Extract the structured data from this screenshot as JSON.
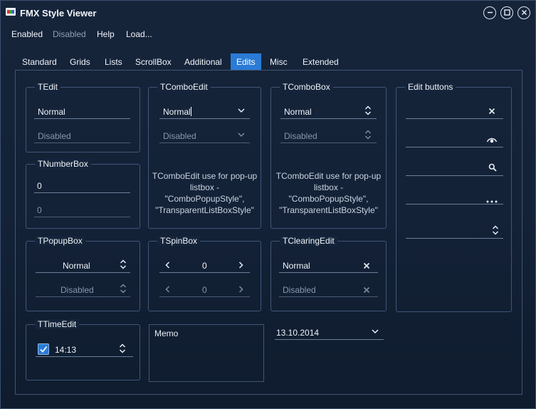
{
  "window": {
    "title": "FMX Style Viewer"
  },
  "menu": {
    "enabled": "Enabled",
    "disabled": "Disabled",
    "help": "Help",
    "load": "Load..."
  },
  "tabs": [
    "Standard",
    "Grids",
    "Lists",
    "ScrollBox",
    "Additional",
    "Edits",
    "Misc",
    "Extended"
  ],
  "active_tab": "Edits",
  "tedit": {
    "title": "TEdit",
    "normal": "Normal",
    "disabled": "Disabled"
  },
  "tnumberbox": {
    "title": "TNumberBox",
    "value": "0",
    "disabled_value": "0"
  },
  "tcomboedit": {
    "title": "TComboEdit",
    "normal": "Normal",
    "disabled": "Disabled",
    "note": [
      "TComboEdit use for pop-up",
      "listbox -",
      "\"ComboPopupStyle\",",
      "\"TransparentListBoxStyle\""
    ]
  },
  "tcombobox": {
    "title": "TComboBox",
    "normal": "Normal",
    "disabled": "Disabled",
    "note": [
      "TComboEdit use for pop-up",
      "listbox -",
      "\"ComboPopupStyle\",",
      "\"TransparentListBoxStyle\""
    ]
  },
  "edit_buttons": {
    "title": "Edit buttons"
  },
  "tpopupbox": {
    "title": "TPopupBox",
    "normal": "Normal",
    "disabled": "Disabled"
  },
  "tspinbox": {
    "title": "TSpinBox",
    "value": "0",
    "disabled_value": "0"
  },
  "tclearingedit": {
    "title": "TClearingEdit",
    "normal": "Normal",
    "disabled": "Disabled"
  },
  "ttimeedit": {
    "title": "TTimeEdit",
    "time": "14:13",
    "checked": true
  },
  "memo": {
    "text": "Memo"
  },
  "dateedit": {
    "value": "13.10.2014"
  }
}
